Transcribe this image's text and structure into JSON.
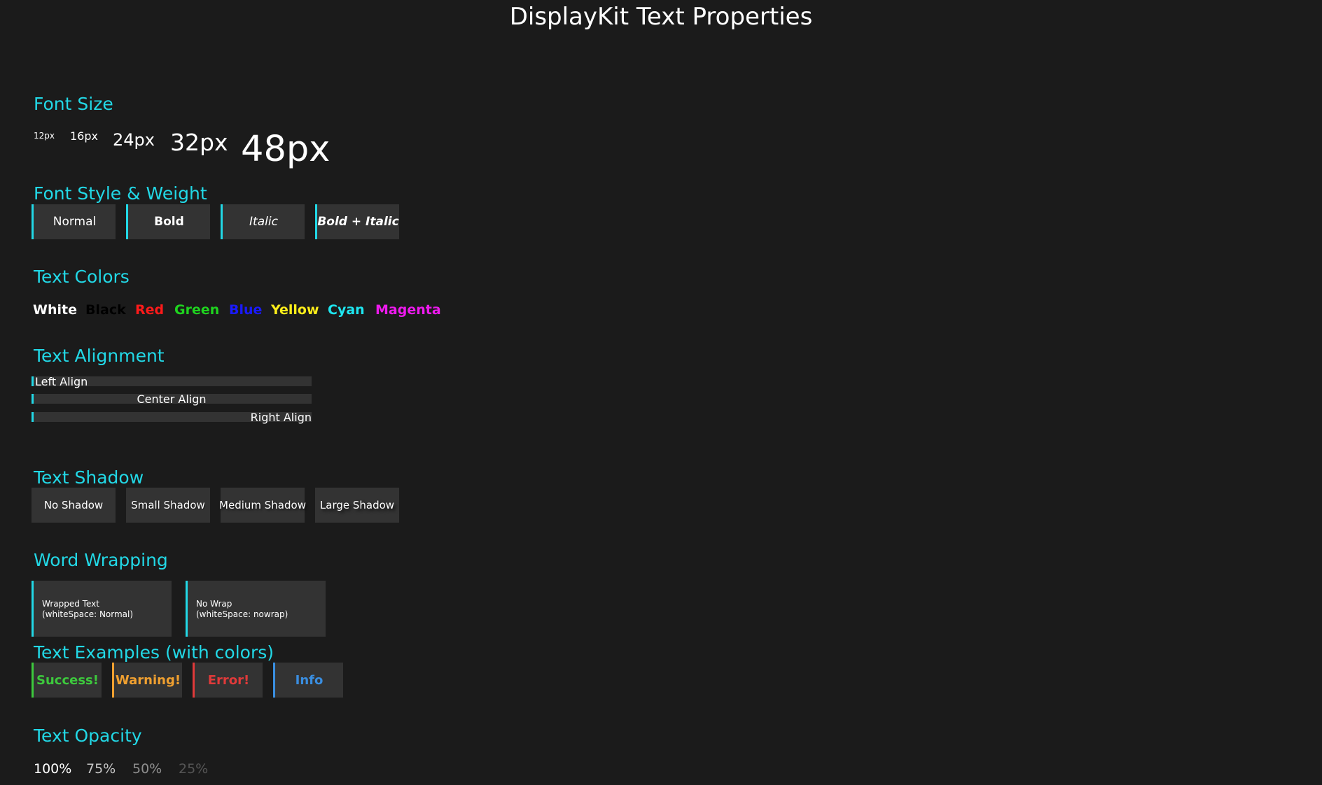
{
  "title": "DisplayKit Text Properties",
  "sections": {
    "font_size": "Font Size",
    "font_style": "Font Style & Weight",
    "text_colors": "Text Colors",
    "text_alignment": "Text Alignment",
    "text_shadow": "Text Shadow",
    "word_wrapping": "Word Wrapping",
    "text_examples": "Text Examples (with colors)",
    "text_opacity": "Text Opacity"
  },
  "font_sizes": [
    "12px",
    "16px",
    "24px",
    "32px",
    "48px"
  ],
  "font_styles": [
    "Normal",
    "Bold",
    "Italic",
    "Bold + Italic"
  ],
  "colors": [
    {
      "label": "White",
      "hex": "#ffffff"
    },
    {
      "label": "Black",
      "hex": "#000000"
    },
    {
      "label": "Red",
      "hex": "#ff1a1a"
    },
    {
      "label": "Green",
      "hex": "#1fd41f"
    },
    {
      "label": "Blue",
      "hex": "#1a1aff"
    },
    {
      "label": "Yellow",
      "hex": "#ffee1a"
    },
    {
      "label": "Cyan",
      "hex": "#1ee6f0"
    },
    {
      "label": "Magenta",
      "hex": "#ee1aee"
    }
  ],
  "alignment": [
    "Left Align",
    "Center Align",
    "Right Align"
  ],
  "shadows": [
    "No Shadow",
    "Small Shadow",
    "Medium Shadow",
    "Large Shadow"
  ],
  "wrapping": {
    "wrapped": {
      "line1": "Wrapped Text",
      "line2": "(whiteSpace: Normal)"
    },
    "nowrap": {
      "line1": "No Wrap",
      "line2": "(whiteSpace: nowrap)"
    }
  },
  "examples": [
    {
      "label": "Success!",
      "hex": "#3dc93d"
    },
    {
      "label": "Warning!",
      "hex": "#f0a030"
    },
    {
      "label": "Error!",
      "hex": "#e03a3a"
    },
    {
      "label": "Info",
      "hex": "#3a8ee0"
    }
  ],
  "opacity": [
    {
      "label": "100%",
      "value": 1.0
    },
    {
      "label": "75%",
      "value": 0.75
    },
    {
      "label": "50%",
      "value": 0.5
    },
    {
      "label": "25%",
      "value": 0.25
    }
  ],
  "accent_color": "#22d8e6"
}
